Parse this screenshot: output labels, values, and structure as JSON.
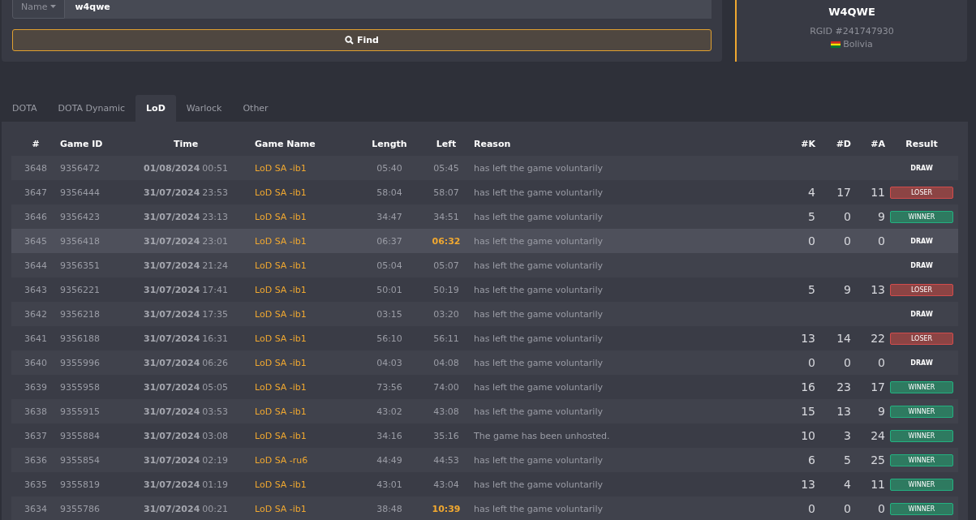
{
  "search": {
    "field_selector": "Name",
    "value": "w4qwe",
    "button": "Find"
  },
  "player": {
    "name": "W4QWE",
    "rgid": "RGID #241747930",
    "country": "Bolivia"
  },
  "tabs": [
    {
      "label": "DOTA",
      "selected": false
    },
    {
      "label": "DOTA Dynamic",
      "selected": false
    },
    {
      "label": "LoD",
      "selected": true
    },
    {
      "label": "Warlock",
      "selected": false
    },
    {
      "label": "Other",
      "selected": false
    }
  ],
  "table": {
    "columns": [
      "#",
      "Game ID",
      "Time",
      "Game Name",
      "Length",
      "Left",
      "Reason",
      "#K",
      "#D",
      "#A",
      "Result"
    ],
    "rows": [
      {
        "n": "3648",
        "game_id": "9356472",
        "date": "01/08/2024",
        "time": "00:51",
        "game_name": "LoD SA -ib1",
        "length": "05:40",
        "left": "05:45",
        "left_warn": false,
        "reason": "has left the game voluntarily",
        "k": "",
        "d": "",
        "a": "",
        "result": "DRAW",
        "kind": "draw",
        "highlighted": false
      },
      {
        "n": "3647",
        "game_id": "9356444",
        "date": "31/07/2024",
        "time": "23:53",
        "game_name": "LoD SA -ib1",
        "length": "58:04",
        "left": "58:07",
        "left_warn": false,
        "reason": "has left the game voluntarily",
        "k": "4",
        "d": "17",
        "a": "11",
        "result": "LOSER",
        "kind": "loser",
        "highlighted": false
      },
      {
        "n": "3646",
        "game_id": "9356423",
        "date": "31/07/2024",
        "time": "23:13",
        "game_name": "LoD SA -ib1",
        "length": "34:47",
        "left": "34:51",
        "left_warn": false,
        "reason": "has left the game voluntarily",
        "k": "5",
        "d": "0",
        "a": "9",
        "result": "WINNER",
        "kind": "winner",
        "highlighted": false
      },
      {
        "n": "3645",
        "game_id": "9356418",
        "date": "31/07/2024",
        "time": "23:01",
        "game_name": "LoD SA -ib1",
        "length": "06:37",
        "left": "06:32",
        "left_warn": true,
        "reason": "has left the game voluntarily",
        "k": "0",
        "d": "0",
        "a": "0",
        "result": "DRAW",
        "kind": "draw",
        "highlighted": true
      },
      {
        "n": "3644",
        "game_id": "9356351",
        "date": "31/07/2024",
        "time": "21:24",
        "game_name": "LoD SA -ib1",
        "length": "05:04",
        "left": "05:07",
        "left_warn": false,
        "reason": "has left the game voluntarily",
        "k": "",
        "d": "",
        "a": "",
        "result": "DRAW",
        "kind": "draw",
        "highlighted": false
      },
      {
        "n": "3643",
        "game_id": "9356221",
        "date": "31/07/2024",
        "time": "17:41",
        "game_name": "LoD SA -ib1",
        "length": "50:01",
        "left": "50:19",
        "left_warn": false,
        "reason": "has left the game voluntarily",
        "k": "5",
        "d": "9",
        "a": "13",
        "result": "LOSER",
        "kind": "loser",
        "highlighted": false
      },
      {
        "n": "3642",
        "game_id": "9356218",
        "date": "31/07/2024",
        "time": "17:35",
        "game_name": "LoD SA -ib1",
        "length": "03:15",
        "left": "03:20",
        "left_warn": false,
        "reason": "has left the game voluntarily",
        "k": "",
        "d": "",
        "a": "",
        "result": "DRAW",
        "kind": "draw",
        "highlighted": false
      },
      {
        "n": "3641",
        "game_id": "9356188",
        "date": "31/07/2024",
        "time": "16:31",
        "game_name": "LoD SA -ib1",
        "length": "56:10",
        "left": "56:11",
        "left_warn": false,
        "reason": "has left the game voluntarily",
        "k": "13",
        "d": "14",
        "a": "22",
        "result": "LOSER",
        "kind": "loser",
        "highlighted": false
      },
      {
        "n": "3640",
        "game_id": "9355996",
        "date": "31/07/2024",
        "time": "06:26",
        "game_name": "LoD SA -ib1",
        "length": "04:03",
        "left": "04:08",
        "left_warn": false,
        "reason": "has left the game voluntarily",
        "k": "0",
        "d": "0",
        "a": "0",
        "result": "DRAW",
        "kind": "draw",
        "highlighted": false
      },
      {
        "n": "3639",
        "game_id": "9355958",
        "date": "31/07/2024",
        "time": "05:05",
        "game_name": "LoD SA -ib1",
        "length": "73:56",
        "left": "74:00",
        "left_warn": false,
        "reason": "has left the game voluntarily",
        "k": "16",
        "d": "23",
        "a": "17",
        "result": "WINNER",
        "kind": "winner",
        "highlighted": false
      },
      {
        "n": "3638",
        "game_id": "9355915",
        "date": "31/07/2024",
        "time": "03:53",
        "game_name": "LoD SA -ib1",
        "length": "43:02",
        "left": "43:08",
        "left_warn": false,
        "reason": "has left the game voluntarily",
        "k": "15",
        "d": "13",
        "a": "9",
        "result": "WINNER",
        "kind": "winner",
        "highlighted": false
      },
      {
        "n": "3637",
        "game_id": "9355884",
        "date": "31/07/2024",
        "time": "03:08",
        "game_name": "LoD SA -ib1",
        "length": "34:16",
        "left": "35:16",
        "left_warn": false,
        "reason": "The game has been unhosted.",
        "k": "10",
        "d": "3",
        "a": "24",
        "result": "WINNER",
        "kind": "winner",
        "highlighted": false
      },
      {
        "n": "3636",
        "game_id": "9355854",
        "date": "31/07/2024",
        "time": "02:19",
        "game_name": "LoD SA -ru6",
        "length": "44:49",
        "left": "44:53",
        "left_warn": false,
        "reason": "has left the game voluntarily",
        "k": "6",
        "d": "5",
        "a": "25",
        "result": "WINNER",
        "kind": "winner",
        "highlighted": false
      },
      {
        "n": "3635",
        "game_id": "9355819",
        "date": "31/07/2024",
        "time": "01:19",
        "game_name": "LoD SA -ib1",
        "length": "43:01",
        "left": "43:04",
        "left_warn": false,
        "reason": "has left the game voluntarily",
        "k": "13",
        "d": "4",
        "a": "11",
        "result": "WINNER",
        "kind": "winner",
        "highlighted": false
      },
      {
        "n": "3634",
        "game_id": "9355786",
        "date": "31/07/2024",
        "time": "00:21",
        "game_name": "LoD SA -ib1",
        "length": "38:48",
        "left": "10:39",
        "left_warn": true,
        "reason": "has left the game voluntarily",
        "k": "0",
        "d": "0",
        "a": "0",
        "result": "WINNER",
        "kind": "winner",
        "highlighted": false
      }
    ]
  }
}
